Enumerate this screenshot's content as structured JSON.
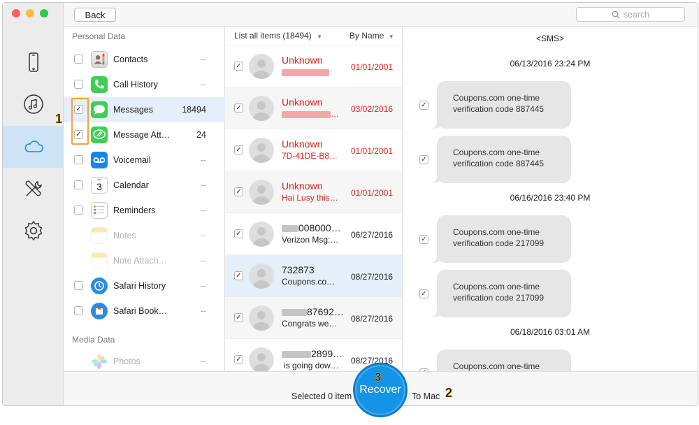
{
  "window": {
    "traffic_colors": [
      "#fc605c",
      "#fdbc40",
      "#34c84a"
    ]
  },
  "rail": {
    "items": [
      {
        "name": "device-icon",
        "active": false
      },
      {
        "name": "itunes-icon",
        "active": false
      },
      {
        "name": "icloud-icon",
        "active": true
      },
      {
        "name": "tools-icon",
        "active": false
      },
      {
        "name": "settings-icon",
        "active": false
      }
    ]
  },
  "topbar": {
    "back_label": "Back",
    "search_placeholder": "search"
  },
  "categories": {
    "personal_label": "Personal Data",
    "media_label": "Media Data",
    "items": [
      {
        "label": "Contacts",
        "count": "--",
        "checked": false,
        "icon": "contacts-icon"
      },
      {
        "label": "Call History",
        "count": "--",
        "checked": false,
        "icon": "phone-icon"
      },
      {
        "label": "Messages",
        "count": "18494",
        "checked": true,
        "icon": "messages-icon"
      },
      {
        "label": "Message Att…",
        "count": "24",
        "checked": true,
        "icon": "message-attachments-icon"
      },
      {
        "label": "Voicemail",
        "count": "--",
        "checked": false,
        "icon": "voicemail-icon"
      },
      {
        "label": "Calendar",
        "count": "--",
        "checked": false,
        "icon": "calendar-icon",
        "calendar_day": "3"
      },
      {
        "label": "Reminders",
        "count": "--",
        "checked": false,
        "icon": "reminders-icon"
      },
      {
        "label": "Notes",
        "count": "--",
        "checked": false,
        "icon": "notes-icon"
      },
      {
        "label": "Note Attach…",
        "count": "--",
        "checked": false,
        "icon": "note-attachments-icon"
      },
      {
        "label": "Safari History",
        "count": "--",
        "checked": false,
        "icon": "safari-history-icon"
      },
      {
        "label": "Safari Book…",
        "count": "--",
        "checked": false,
        "icon": "safari-bookmarks-icon"
      }
    ],
    "media_items": [
      {
        "label": "Photos",
        "count": "--",
        "checked": false,
        "icon": "photos-icon"
      }
    ]
  },
  "list": {
    "header_label": "List all items (18494)",
    "sort_label": "By Name",
    "rows": [
      {
        "name": "Unknown",
        "sub": "",
        "date": "01/01/2001",
        "red": true,
        "blur_name": false,
        "blur_sub": true
      },
      {
        "name": "Unknown",
        "sub": "…",
        "date": "03/02/2016",
        "red": true,
        "blur_name": false,
        "blur_sub": true
      },
      {
        "name": "Unknown",
        "sub": "7D-41DE-B8…",
        "date": "01/01/2001",
        "red": true,
        "blur_name": false,
        "blur_sub": false
      },
      {
        "name": "Unknown",
        "sub": "Hai Lusy this…",
        "date": "01/01/2001",
        "red": true,
        "blur_name": false,
        "blur_sub": false
      },
      {
        "name": "008000…",
        "sub": "Verizon Msg:…",
        "date": "06/27/2016",
        "red": false,
        "blur_name": true,
        "blur_sub": false
      },
      {
        "name": "732873",
        "sub": "Coupons.co…",
        "date": "08/27/2016",
        "red": false,
        "blur_name": false,
        "blur_sub": false,
        "selected": true
      },
      {
        "name": "87692…",
        "sub": "Congrats we…",
        "date": "08/27/2016",
        "red": false,
        "blur_name": true,
        "blur_sub": false
      },
      {
        "name": "2899…",
        "sub": "is going dow…",
        "date": "08/27/2016",
        "red": false,
        "blur_name": true,
        "blur_sub": false
      }
    ]
  },
  "conversation": {
    "title": "<SMS>",
    "items": [
      {
        "type": "ts",
        "text": "06/13/2016 23:24 PM"
      },
      {
        "type": "msg",
        "line1": "Coupons.com one-time",
        "line2": "verification code 887445"
      },
      {
        "type": "msg",
        "line1": "Coupons.com one-time",
        "line2": "verification code 887445"
      },
      {
        "type": "ts",
        "text": "06/16/2016 23:40 PM"
      },
      {
        "type": "msg",
        "line1": "Coupons.com one-time",
        "line2": "verification code 217099"
      },
      {
        "type": "msg",
        "line1": "Coupons.com one-time",
        "line2": "verification code 217099"
      },
      {
        "type": "ts",
        "text": "06/18/2016 03:01 AM"
      },
      {
        "type": "msg",
        "line1": "Coupons.com one-time",
        "line2": ""
      }
    ]
  },
  "bottombar": {
    "selected_text": "Selected 0 item",
    "recover_label": "Recover",
    "to_mac_label": "To Mac"
  },
  "annotations": {
    "step1": "1",
    "step2": "2",
    "step3": "3",
    "accent": "#f5a33a"
  }
}
